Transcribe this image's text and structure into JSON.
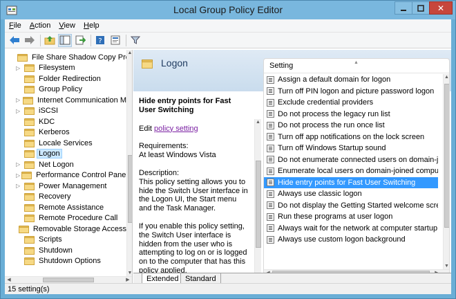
{
  "window": {
    "title": "Local Group Policy Editor"
  },
  "menubar": [
    {
      "label": "File",
      "key": "F"
    },
    {
      "label": "Action",
      "key": "A"
    },
    {
      "label": "View",
      "key": "V"
    },
    {
      "label": "Help",
      "key": "H"
    }
  ],
  "toolbar": [
    "back-icon",
    "forward-icon",
    "up-folder-icon",
    "show-hide-tree-icon",
    "export-list-icon",
    "help-icon",
    "properties-icon",
    "filter-icon"
  ],
  "tree": {
    "items": [
      {
        "label": "File Share Shadow Copy Pro",
        "expandable": false
      },
      {
        "label": "Filesystem",
        "expandable": true
      },
      {
        "label": "Folder Redirection",
        "expandable": false
      },
      {
        "label": "Group Policy",
        "expandable": false
      },
      {
        "label": "Internet Communication M",
        "expandable": true
      },
      {
        "label": "iSCSI",
        "expandable": true
      },
      {
        "label": "KDC",
        "expandable": false
      },
      {
        "label": "Kerberos",
        "expandable": false
      },
      {
        "label": "Locale Services",
        "expandable": false
      },
      {
        "label": "Logon",
        "expandable": false,
        "selected": true
      },
      {
        "label": "Net Logon",
        "expandable": true
      },
      {
        "label": "Performance Control Panel",
        "expandable": true
      },
      {
        "label": "Power Management",
        "expandable": true
      },
      {
        "label": "Recovery",
        "expandable": false
      },
      {
        "label": "Remote Assistance",
        "expandable": false
      },
      {
        "label": "Remote Procedure Call",
        "expandable": false
      },
      {
        "label": "Removable Storage Access",
        "expandable": false
      },
      {
        "label": "Scripts",
        "expandable": false
      },
      {
        "label": "Shutdown",
        "expandable": false
      },
      {
        "label": "Shutdown Options",
        "expandable": false
      }
    ]
  },
  "header": {
    "title": "Logon"
  },
  "description": {
    "title": "Hide entry points for Fast User Switching",
    "edit_prefix": "Edit",
    "edit_link": "policy setting",
    "requirements_label": "Requirements:",
    "requirements_value": "At least Windows Vista",
    "description_label": "Description:",
    "paragraph1": "This policy setting allows you to hide the Switch User interface in the Logon UI, the Start menu and the Task Manager.",
    "paragraph2": "If you enable this policy setting, the Switch User interface is hidden from the user who is attempting to log on or is logged on to the computer that has this policy applied."
  },
  "settings": {
    "column_header": "Setting",
    "items": [
      "Assign a default domain for logon",
      "Turn off PIN logon and picture password logon",
      "Exclude credential providers",
      "Do not process the legacy run list",
      "Do not process the run once list",
      "Turn off app notifications on the lock screen",
      "Turn off Windows Startup sound",
      "Do not enumerate connected users on domain-joine",
      "Enumerate local users on domain-joined computers",
      "Hide entry points for Fast User Switching",
      "Always use classic logon",
      "Do not display the Getting Started welcome screen a",
      "Run these programs at user logon",
      "Always wait for the network at computer startup and",
      "Always use custom logon background"
    ],
    "selected_index": 9
  },
  "tabs": [
    "Extended",
    "Standard"
  ],
  "status": {
    "text": "15 setting(s)"
  },
  "colors": {
    "selection": "#3399ff",
    "title_bar": "#79b7de",
    "link": "#7a1fa2"
  }
}
